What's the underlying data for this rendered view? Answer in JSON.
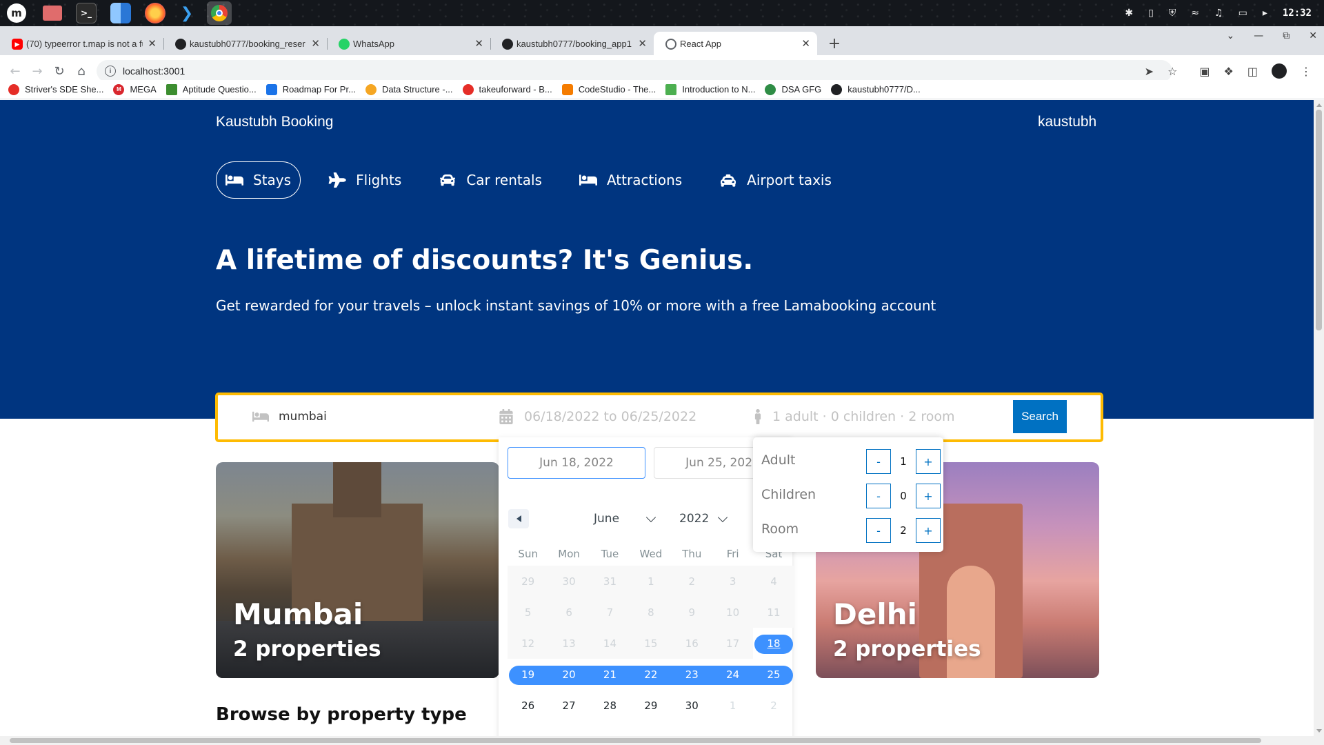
{
  "os": {
    "apps": [
      "mint-menu",
      "files",
      "terminal",
      "finder",
      "firefox",
      "vscode",
      "chrome"
    ],
    "clock": "12:32"
  },
  "browser": {
    "tabs": [
      {
        "title": "(70) typeerror t.map is not a fu",
        "favicon": "youtube-icon",
        "color": "#ff0000"
      },
      {
        "title": "kaustubh0777/booking_reser",
        "favicon": "github-icon",
        "color": "#202124"
      },
      {
        "title": "WhatsApp",
        "favicon": "whatsapp-icon",
        "color": "#25d366"
      },
      {
        "title": "kaustubh0777/booking_app1",
        "favicon": "github-icon",
        "color": "#202124"
      },
      {
        "title": "React App",
        "favicon": "globe-icon",
        "color": "#5f6368"
      }
    ],
    "url": "localhost:3001",
    "bookmarks": [
      {
        "label": "Striver's SDE She...",
        "color": "#e52d27"
      },
      {
        "label": "MEGA",
        "color": "#d9272e"
      },
      {
        "label": "Aptitude Questio...",
        "color": "#3c8d2f"
      },
      {
        "label": "Roadmap For Pr...",
        "color": "#1a73e8"
      },
      {
        "label": "Data Structure -...",
        "color": "#f5a623"
      },
      {
        "label": "takeuforward - B...",
        "color": "#e52d27"
      },
      {
        "label": "CodeStudio - The...",
        "color": "#f57c00"
      },
      {
        "label": "Introduction to N...",
        "color": "#4caf50"
      },
      {
        "label": "DSA GFG",
        "color": "#2f8d46"
      },
      {
        "label": "kaustubh0777/D...",
        "color": "#202124"
      }
    ]
  },
  "header": {
    "brand": "Kaustubh Booking",
    "user": "kaustubh",
    "nav": [
      {
        "label": "Stays",
        "icon": "bed-icon",
        "active": true
      },
      {
        "label": "Flights",
        "icon": "plane-icon",
        "active": false
      },
      {
        "label": "Car rentals",
        "icon": "car-icon",
        "active": false
      },
      {
        "label": "Attractions",
        "icon": "bed-icon",
        "active": false
      },
      {
        "label": "Airport taxis",
        "icon": "taxi-icon",
        "active": false
      }
    ],
    "headline": "A lifetime of discounts? It's Genius.",
    "subline": "Get rewarded for your travels – unlock instant savings of 10% or more with a free Lamabooking account"
  },
  "search": {
    "destination": "mumbai",
    "dates": "06/18/2022 to 06/25/2022",
    "options": "1 adult · 0 children · 2 room",
    "button": "Search"
  },
  "daterange": {
    "start_input": "Jun 18, 2022",
    "end_input": "Jun 25, 2022",
    "month": "June",
    "year": "2022",
    "weekdays": [
      "Sun",
      "Mon",
      "Tue",
      "Wed",
      "Thu",
      "Fri",
      "Sat"
    ],
    "days": [
      [
        "29",
        "30",
        "31",
        "1",
        "2",
        "3",
        "4"
      ],
      [
        "5",
        "6",
        "7",
        "8",
        "9",
        "10",
        "11"
      ],
      [
        "12",
        "13",
        "14",
        "15",
        "16",
        "17",
        "18"
      ],
      [
        "19",
        "20",
        "21",
        "22",
        "23",
        "24",
        "25"
      ],
      [
        "26",
        "27",
        "28",
        "29",
        "30",
        "1",
        "2"
      ]
    ]
  },
  "options": {
    "rows": [
      {
        "label": "Adult",
        "value": "1"
      },
      {
        "label": "Children",
        "value": "0"
      },
      {
        "label": "Room",
        "value": "2"
      }
    ],
    "minus": "-",
    "plus": "+"
  },
  "cities": [
    {
      "name": "Mumbai",
      "properties": "2 properties"
    },
    {
      "name": "Delhi",
      "properties": "2 properties"
    }
  ],
  "section_title": "Browse by property type"
}
